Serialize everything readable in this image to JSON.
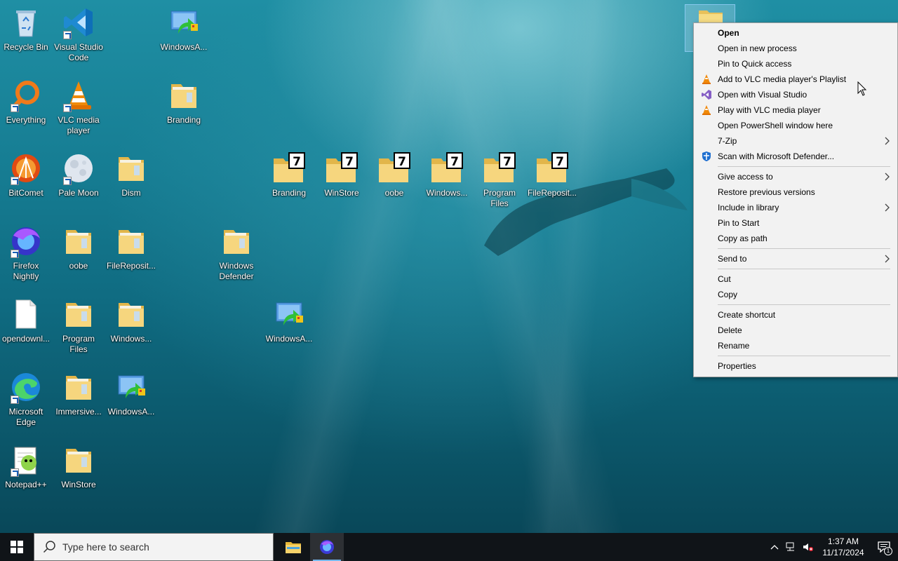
{
  "desktop": {
    "icons": [
      {
        "label": "Recycle Bin",
        "kind": "recycle-bin-icon",
        "shortcut": false
      },
      {
        "label": "Visual Studio Code",
        "kind": "vscode-icon",
        "shortcut": true
      },
      {
        "label": "WindowsA...",
        "kind": "windows-app-icon",
        "shortcut": false
      },
      {
        "label": "Everything",
        "kind": "everything-search-icon",
        "shortcut": true
      },
      {
        "label": "VLC media player",
        "kind": "vlc-icon",
        "shortcut": true
      },
      {
        "label": "Branding",
        "kind": "folder-icon",
        "shortcut": false
      },
      {
        "label": "BitComet",
        "kind": "bitcomet-icon",
        "shortcut": true
      },
      {
        "label": "Pale Moon",
        "kind": "pale-moon-icon",
        "shortcut": true
      },
      {
        "label": "Dism",
        "kind": "folder-icon",
        "shortcut": false
      },
      {
        "label": "Branding",
        "kind": "7zip-archive-icon",
        "shortcut": false
      },
      {
        "label": "WinStore",
        "kind": "7zip-archive-icon",
        "shortcut": false
      },
      {
        "label": "oobe",
        "kind": "7zip-archive-icon",
        "shortcut": false
      },
      {
        "label": "Windows...",
        "kind": "7zip-archive-icon",
        "shortcut": false
      },
      {
        "label": "Program Files",
        "kind": "7zip-archive-icon",
        "shortcut": false
      },
      {
        "label": "FileReposit...",
        "kind": "7zip-archive-icon",
        "shortcut": false
      },
      {
        "label": "Firefox Nightly",
        "kind": "firefox-nightly-icon",
        "shortcut": true
      },
      {
        "label": "oobe",
        "kind": "folder-icon",
        "shortcut": false
      },
      {
        "label": "FileReposit...",
        "kind": "folder-icon",
        "shortcut": false
      },
      {
        "label": "Windows Defender",
        "kind": "folder-icon",
        "shortcut": false
      },
      {
        "label": "opendownl...",
        "kind": "file-icon",
        "shortcut": false
      },
      {
        "label": "Program Files",
        "kind": "folder-icon",
        "shortcut": false
      },
      {
        "label": "Windows...",
        "kind": "folder-icon",
        "shortcut": false
      },
      {
        "label": "WindowsA...",
        "kind": "windows-app-icon",
        "shortcut": false
      },
      {
        "label": "Microsoft Edge",
        "kind": "edge-icon",
        "shortcut": true
      },
      {
        "label": "Immersive...",
        "kind": "folder-icon",
        "shortcut": false
      },
      {
        "label": "WindowsA...",
        "kind": "windows-app-icon",
        "shortcut": false
      },
      {
        "label": "Notepad++",
        "kind": "notepadpp-icon",
        "shortcut": true
      },
      {
        "label": "WinStore",
        "kind": "folder-icon",
        "shortcut": false
      }
    ]
  },
  "context_menu": {
    "items": [
      {
        "label": "Open",
        "bold": true
      },
      {
        "label": "Open in new process"
      },
      {
        "label": "Pin to Quick access"
      },
      {
        "label": "Add to VLC media player's Playlist",
        "icon": "vlc-cone-icon"
      },
      {
        "label": "Open with Visual Studio",
        "icon": "visual-studio-icon"
      },
      {
        "label": "Play with VLC media player",
        "icon": "vlc-cone-icon"
      },
      {
        "label": "Open PowerShell window here"
      },
      {
        "label": "7-Zip",
        "submenu": true
      },
      {
        "label": "Scan with Microsoft Defender...",
        "icon": "defender-shield-icon"
      },
      {
        "separator": true
      },
      {
        "label": "Give access to",
        "submenu": true
      },
      {
        "label": "Restore previous versions"
      },
      {
        "label": "Include in library",
        "submenu": true
      },
      {
        "label": "Pin to Start"
      },
      {
        "label": "Copy as path"
      },
      {
        "separator": true
      },
      {
        "label": "Send to",
        "submenu": true
      },
      {
        "separator": true
      },
      {
        "label": "Cut"
      },
      {
        "label": "Copy"
      },
      {
        "separator": true
      },
      {
        "label": "Create shortcut"
      },
      {
        "label": "Delete"
      },
      {
        "label": "Rename"
      },
      {
        "separator": true
      },
      {
        "label": "Properties"
      }
    ]
  },
  "taskbar": {
    "search_placeholder": "Type here to search",
    "time": "1:37 AM",
    "date": "11/17/2024",
    "notification_count": "1"
  },
  "colors": {
    "folder": "#f3d67a",
    "taskbar": "#101418",
    "menu_bg": "#f2f2f2",
    "accent": "#76b9ed"
  }
}
